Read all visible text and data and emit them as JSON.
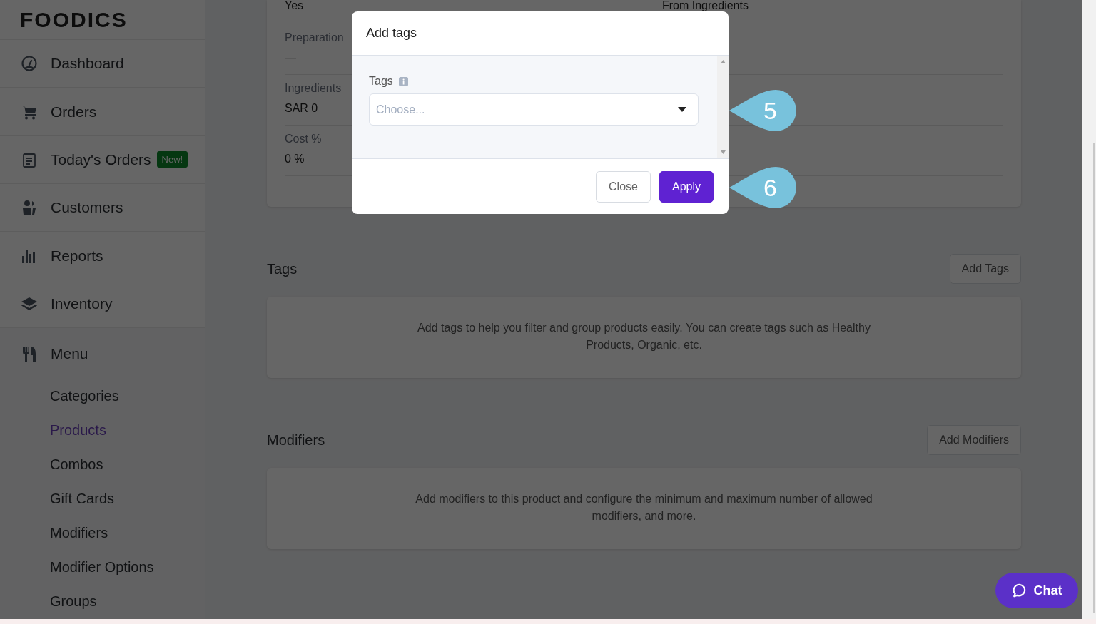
{
  "brand": "FOODICS",
  "sidebar": {
    "items": [
      {
        "label": "Dashboard"
      },
      {
        "label": "Orders"
      },
      {
        "label": "Today's Orders",
        "badge": "New!"
      },
      {
        "label": "Customers"
      },
      {
        "label": "Reports"
      },
      {
        "label": "Inventory"
      },
      {
        "label": "Menu",
        "expanded": true,
        "children": [
          {
            "label": "Categories",
            "selected": false
          },
          {
            "label": "Products",
            "selected": true
          },
          {
            "label": "Combos",
            "selected": false
          },
          {
            "label": "Gift Cards",
            "selected": false
          },
          {
            "label": "Modifiers",
            "selected": false
          },
          {
            "label": "Modifier Options",
            "selected": false
          },
          {
            "label": "Groups",
            "selected": false
          }
        ]
      }
    ]
  },
  "details": [
    {
      "value": "Yes",
      "right_value": "From Ingredients"
    },
    {
      "label": "Preparation",
      "value": "—"
    },
    {
      "label": "Ingredients",
      "value": "SAR 0"
    },
    {
      "label": "Cost %",
      "value": "0 %"
    }
  ],
  "sections": [
    {
      "title": "Tags",
      "button": "Add Tags",
      "text": "Add tags to help you filter and group products easily. You can create tags such as Healthy Products, Organic, etc."
    },
    {
      "title": "Modifiers",
      "button": "Add Modifiers",
      "text": "Add modifiers to this product and configure the minimum and maximum number of allowed modifiers, and more."
    }
  ],
  "modal": {
    "title": "Add tags",
    "field_label": "Tags",
    "placeholder": "Choose...",
    "buttons": [
      {
        "label": "Close",
        "kind": "secondary"
      },
      {
        "label": "Apply",
        "kind": "primary"
      }
    ]
  },
  "callouts": [
    "5",
    "6"
  ],
  "chat": {
    "label": "Chat"
  }
}
